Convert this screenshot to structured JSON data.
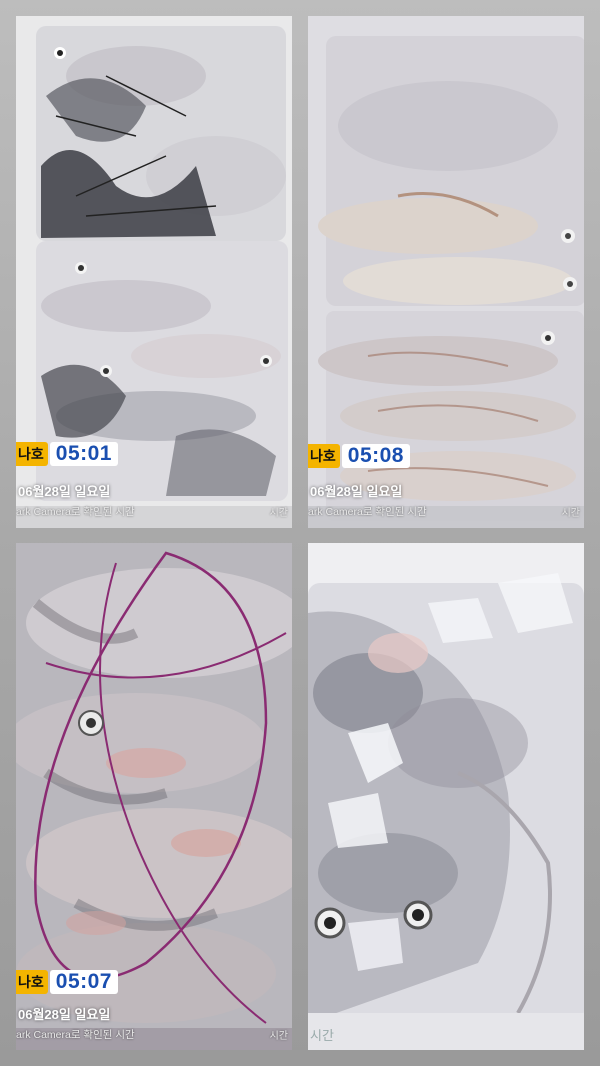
{
  "photos": [
    {
      "tag": "나호",
      "time": "05:01",
      "date": "06월28일 일요일",
      "caption": "ark Camera로 확인된 시간",
      "corner": "시간"
    },
    {
      "tag": "나호",
      "time": "05:08",
      "date": "06월28일 일요일",
      "caption": "ark Camera로 확인된 시간",
      "corner": "시간"
    },
    {
      "tag": "나호",
      "time": "05:07",
      "date": "06월28일 일요일",
      "caption": "ark Camera로 확인된 시간",
      "corner": "시간"
    },
    {
      "corner": "시간"
    }
  ]
}
